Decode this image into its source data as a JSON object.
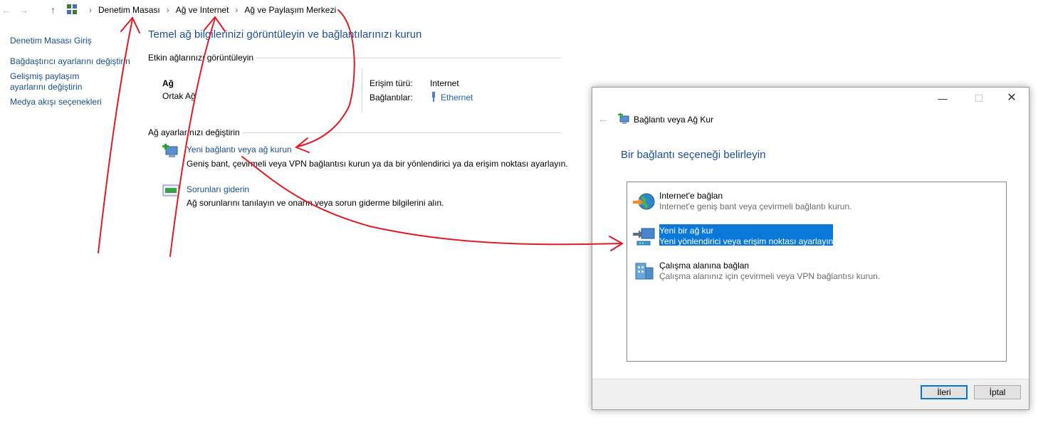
{
  "address_bar": {
    "crumbs": [
      "Denetim Masası",
      "Ağ ve Internet",
      "Ağ ve Paylaşım Merkezi"
    ]
  },
  "left_pane": {
    "items": [
      "Denetim Masası Giriş",
      "Bağdaştırıcı ayarlarını değiştirin",
      "Gelişmiş paylaşım ayarlarını değiştirin",
      "Medya akışı seçenekleri"
    ]
  },
  "main": {
    "title": "Temel ağ bilgilerinizi görüntüleyin ve bağlantılarınızı kurun",
    "active_networks_header": "Etkin ağlarınızı görüntüleyin",
    "network_name": "Ağ",
    "network_category": "Ortak Ağ",
    "access_type_label": "Erişim türü:",
    "access_type_value": "Internet",
    "connections_label": "Bağlantılar:",
    "connections_value": "Ethernet",
    "change_settings_header": "Ağ ayarlarınızı değiştirin",
    "tasks": [
      {
        "link": "Yeni bağlantı veya ağ kurun",
        "desc": "Geniş bant, çevirmeli veya VPN bağlantısı kurun ya da bir yönlendirici ya da erişim noktası ayarlayın."
      },
      {
        "link": "Sorunları giderin",
        "desc": "Ağ sorunlarını tanılayın ve onarın veya sorun giderme bilgilerini alın."
      }
    ]
  },
  "dialog": {
    "title": "Bağlantı veya Ağ Kur",
    "heading": "Bir bağlantı seçeneği belirleyin",
    "options": [
      {
        "title": "Internet'e bağlan",
        "desc": "Internet'e geniş bant veya çevirmeli bağlantı kurun.",
        "selected": false
      },
      {
        "title": "Yeni bir ağ kur",
        "desc": "Yeni yönlendirici veya erişim noktası ayarlayın.",
        "selected": true
      },
      {
        "title": "Çalışma alanına bağlan",
        "desc": "Çalışma alanınız için çevirmeli veya VPN bağlantısı kurun.",
        "selected": false
      }
    ],
    "next_label": "İleri",
    "cancel_label": "İptal"
  },
  "colors": {
    "link": "#1a4f8a",
    "title": "#1e4e9a",
    "selection": "#0a78d7",
    "annotation": "#e01b24"
  }
}
